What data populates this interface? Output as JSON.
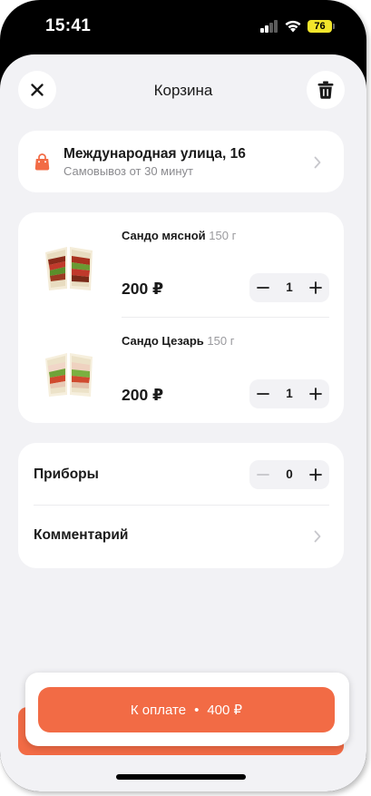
{
  "status_bar": {
    "time": "15:41",
    "battery": "76"
  },
  "header": {
    "title": "Корзина",
    "close_icon": "close-icon",
    "trash_icon": "trash-icon"
  },
  "pickup": {
    "address": "Международная улица, 16",
    "subtitle": "Самовывоз от 30 минут",
    "icon": "shopping-bag-icon",
    "icon_color": "#f26b45"
  },
  "items": [
    {
      "name": "Сандо мясной",
      "weight": "150 г",
      "price": "200 ₽",
      "qty": "1"
    },
    {
      "name": "Сандо Цезарь",
      "weight": "150 г",
      "price": "200 ₽",
      "qty": "1"
    }
  ],
  "extras": {
    "cutlery_label": "Приборы",
    "cutlery_qty": "0",
    "comment_label": "Комментарий"
  },
  "checkout": {
    "label": "К оплате",
    "separator": "•",
    "total": "400 ₽"
  },
  "colors": {
    "accent": "#f26b45",
    "background": "#f2f2f5",
    "muted_text": "#8b8b8f"
  }
}
